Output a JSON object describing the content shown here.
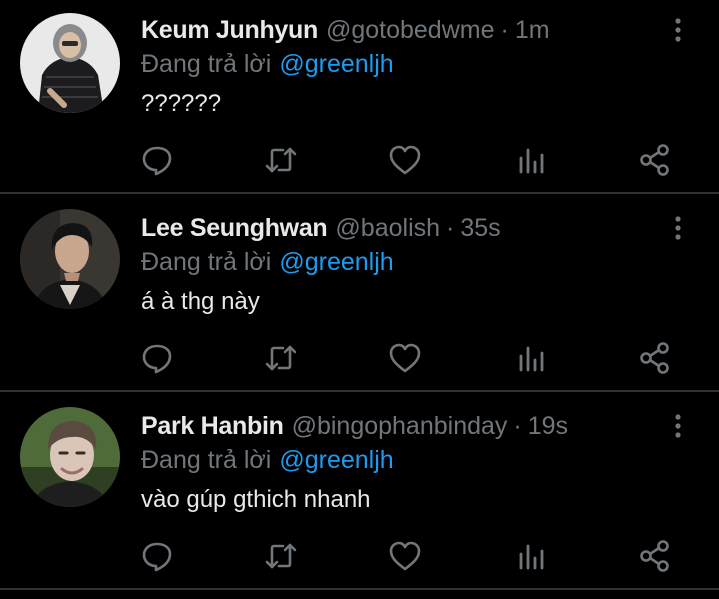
{
  "colors": {
    "background": "#000000",
    "text": "#e7e9ea",
    "muted": "#71767b",
    "link": "#1d9bf0",
    "divider": "#2f3336"
  },
  "icons": {
    "more": "more-vertical-icon",
    "reply": "comment-bubble-icon",
    "retweet": "retweet-icon",
    "like": "heart-icon",
    "stats": "bar-chart-icon",
    "share": "share-icon"
  },
  "tweets": [
    {
      "name": "Keum Junhyun",
      "handle": "@gotobedwme",
      "separator": "·",
      "time": "1m",
      "reply_prefix": "Đang trả lời",
      "reply_to": "@greenljh",
      "text": "??????"
    },
    {
      "name": "Lee Seunghwan",
      "handle": "@baolish",
      "separator": "·",
      "time": "35s",
      "reply_prefix": "Đang trả lời",
      "reply_to": "@greenljh",
      "text": "á à thg này"
    },
    {
      "name": "Park Hanbin",
      "handle": "@bingophanbinday",
      "separator": "·",
      "time": "19s",
      "reply_prefix": "Đang trả lời",
      "reply_to": "@greenljh",
      "text": "vào gúp gthich nhanh"
    }
  ]
}
